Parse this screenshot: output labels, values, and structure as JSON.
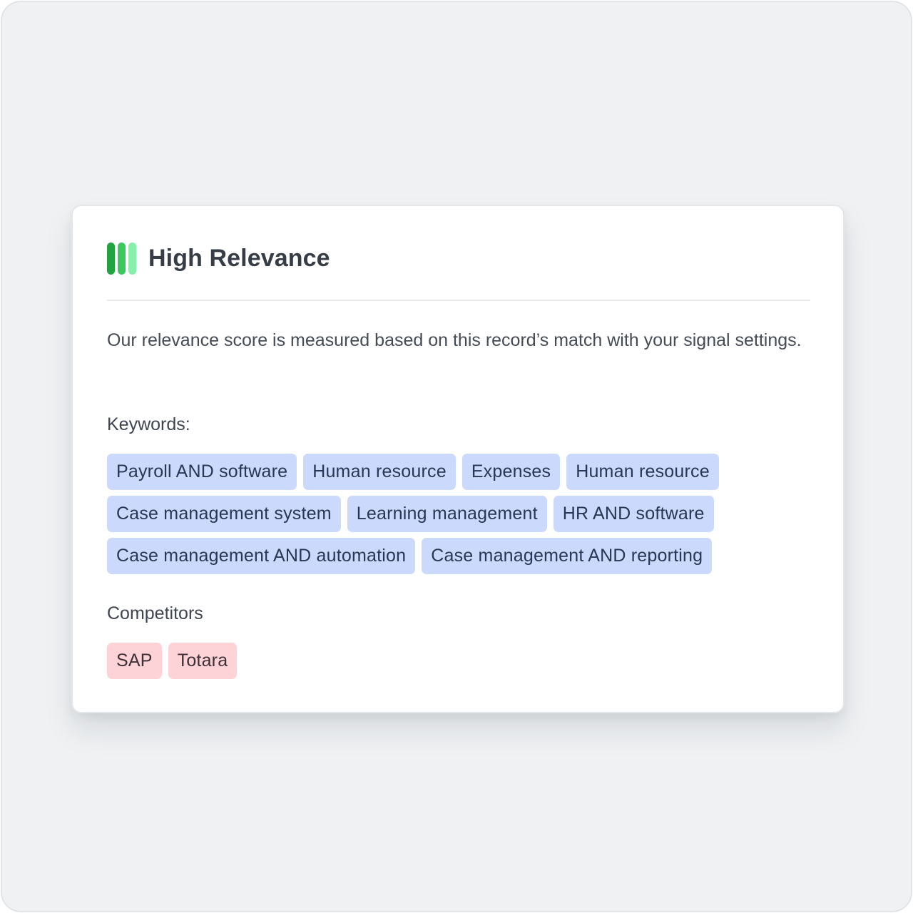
{
  "card": {
    "title": "High Relevance",
    "description": "Our relevance score is measured based on this record’s match with your signal settings.",
    "relevance_icon": {
      "name": "relevance-bars-icon",
      "bar_colors": [
        "#22a33f",
        "#3cc85f",
        "#86f0aa"
      ]
    },
    "keywords_label": "Keywords:",
    "keywords": [
      "Payroll AND software",
      "Human resource",
      "Expenses",
      "Human resource",
      "Case management system",
      "Learning management",
      "HR AND software",
      "Case management AND automation",
      "Case management AND reporting"
    ],
    "competitors_label": "Competitors",
    "competitors": [
      "SAP",
      "Totara"
    ]
  },
  "colors": {
    "keyword_chip_bg": "#cad9fc",
    "competitor_chip_bg": "#fdd3d7",
    "title_text": "#373d47"
  }
}
